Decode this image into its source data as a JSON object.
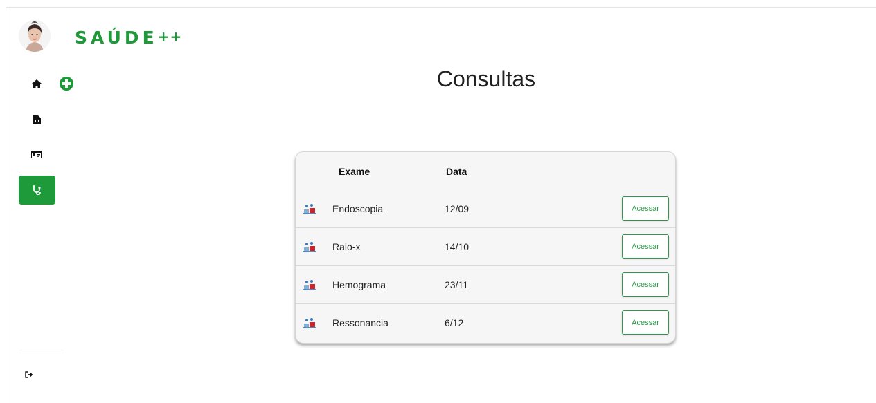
{
  "brand": {
    "name": "SAÚDE",
    "suffix": "++",
    "color": "#1f9a3a"
  },
  "sidebar": {
    "items": [
      {
        "id": "home",
        "icon": "home-icon"
      },
      {
        "id": "add",
        "icon": "plus-circle-icon"
      },
      {
        "id": "documents",
        "icon": "file-icon"
      },
      {
        "id": "id-card",
        "icon": "id-card-icon"
      },
      {
        "id": "consultas",
        "icon": "stethoscope-icon",
        "active": true
      },
      {
        "id": "logout",
        "icon": "sign-out-icon"
      }
    ]
  },
  "main": {
    "title": "Consultas",
    "table": {
      "headers": {
        "exam": "Exame",
        "date": "Data"
      },
      "rows": [
        {
          "exam": "Endoscopia",
          "date": "12/09",
          "action": "Acessar",
          "icon": "medical-exam-icon"
        },
        {
          "exam": "Raio-x",
          "date": "14/10",
          "action": "Acessar",
          "icon": "medical-exam-icon"
        },
        {
          "exam": "Hemograma",
          "date": "23/11",
          "action": "Acessar",
          "icon": "medical-exam-icon"
        },
        {
          "exam": "Ressonancia",
          "date": "6/12",
          "action": "Acessar",
          "icon": "medical-exam-icon"
        }
      ]
    }
  }
}
